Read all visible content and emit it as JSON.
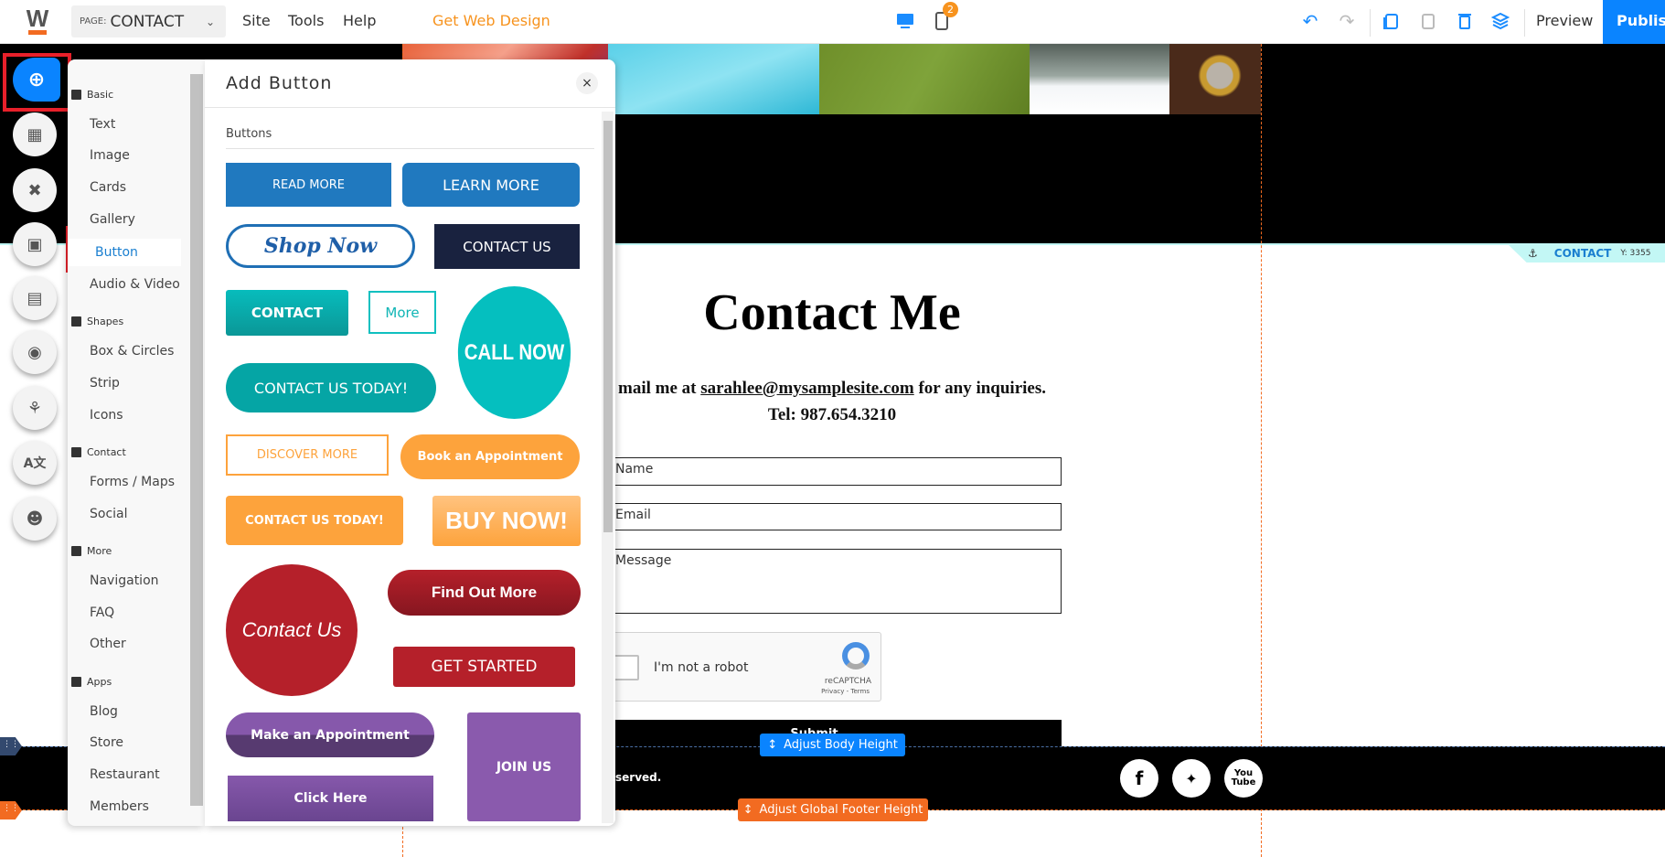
{
  "topbar": {
    "logo": "W",
    "page_prefix": "PAGE:",
    "page_name": "CONTACT",
    "menu": [
      "Site",
      "Tools",
      "Help"
    ],
    "cta": "Get Web Design",
    "device_badge": "2",
    "preview": "Preview",
    "publish": "Publish"
  },
  "colors": {
    "accent": "#0a84ff",
    "orange": "#f7931e",
    "highlight": "#e8202a"
  },
  "section_anchor": {
    "label": "CONTACT",
    "y": "Y: 3355"
  },
  "page": {
    "heading": "Contact Me",
    "email_prefix": "mail me at",
    "email": "sarahlee@mysamplesite.com",
    "email_suffix": "for any inquiries.",
    "tel": "Tel: 987.654.3210",
    "fields": {
      "name": "Name",
      "email": "Email",
      "message": "Message"
    },
    "captcha": {
      "label": "I'm not a robot",
      "brand": "reCAPTCHA",
      "links": "Privacy - Terms"
    },
    "submit": "Submit",
    "footer_text": "served.",
    "social": [
      "facebook",
      "twitter",
      "youtube"
    ]
  },
  "editor": {
    "adjust_body": "Adjust Body Height",
    "adjust_footer": "Adjust Global Footer Height"
  },
  "rail_icons": [
    "add-icon",
    "layout-icon",
    "design-icon",
    "folder-icon",
    "store-icon",
    "blog-icon",
    "restaurant-icon",
    "translate-icon",
    "members-icon"
  ],
  "categories": [
    {
      "type": "header",
      "label": "Basic"
    },
    {
      "label": "Text"
    },
    {
      "label": "Image"
    },
    {
      "label": "Cards"
    },
    {
      "label": "Gallery"
    },
    {
      "label": "Button",
      "selected": true
    },
    {
      "label": "Audio & Video"
    },
    {
      "type": "header",
      "label": "Shapes"
    },
    {
      "label": "Box & Circles"
    },
    {
      "label": "Strip"
    },
    {
      "label": "Icons"
    },
    {
      "type": "header",
      "label": "Contact"
    },
    {
      "label": "Forms / Maps"
    },
    {
      "label": "Social"
    },
    {
      "type": "header",
      "label": "More"
    },
    {
      "label": "Navigation"
    },
    {
      "label": "FAQ"
    },
    {
      "label": "Other"
    },
    {
      "type": "header",
      "label": "Apps"
    },
    {
      "label": "Blog"
    },
    {
      "label": "Store"
    },
    {
      "label": "Restaurant"
    },
    {
      "label": "Members"
    }
  ],
  "flyout": {
    "title": "Add Button",
    "close": "×",
    "section": "Buttons",
    "buttons": [
      "READ MORE",
      "LEARN MORE",
      "Shop Now",
      "CONTACT US",
      "CONTACT",
      "More",
      "CALL NOW",
      "CONTACT US TODAY!",
      "DISCOVER MORE",
      "Book an Appointment",
      "CONTACT US TODAY!",
      "BUY NOW!",
      "Contact Us",
      "Find Out More",
      "GET STARTED",
      "Make an Appointment",
      "JOIN US",
      "Click Here"
    ]
  }
}
